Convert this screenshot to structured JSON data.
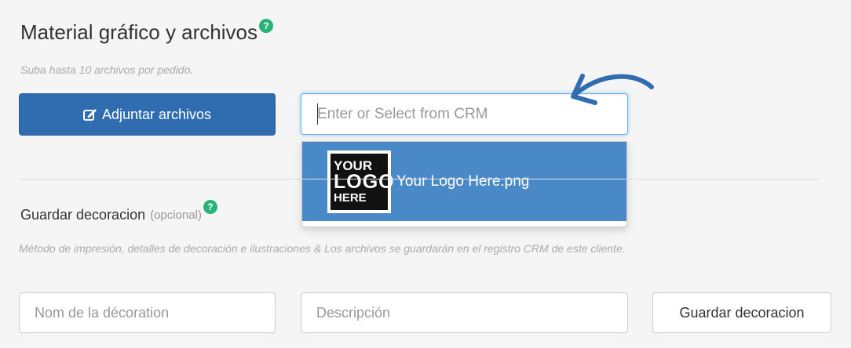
{
  "artwork": {
    "title": "Material gráfico y archivos",
    "help_glyph": "?",
    "hint": "Suba hasta 10 archivos por pedido.",
    "attach_button_label": "Adjuntar archivos",
    "attach_icon": "edit-icon",
    "crm_placeholder": "Enter or Select from CRM",
    "dropdown_items": [
      {
        "label": "Your Logo Here.png",
        "thumb_text": [
          "YOUR",
          "LOGO",
          "HERE"
        ]
      }
    ]
  },
  "decoration": {
    "title": "Guardar decoracion",
    "optional": "(opcional)",
    "help_glyph": "?",
    "hint": "Método de impresión, detalles de decoración e ilustraciones & Los archivos se guardarán en el registro CRM de este cliente.",
    "name_placeholder": "Nom de la décoration",
    "description_placeholder": "Descripción",
    "save_button_label": "Guardar decoracion"
  },
  "colors": {
    "primary": "#2f6cb0",
    "dropdown_highlight": "#4a89c8",
    "help_badge": "#2ab27b",
    "annotation_arrow": "#2f6cb0"
  }
}
